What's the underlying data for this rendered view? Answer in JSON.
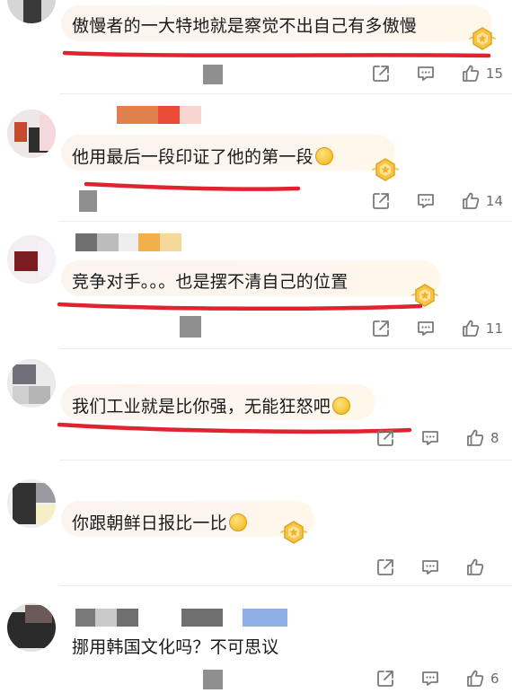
{
  "comments": [
    {
      "text": "傲慢者的一大特地就是察觉不出自己有多傲慢",
      "emoji": "",
      "likes": "15"
    },
    {
      "text": "他用最后一段印证了他的第一段",
      "emoji": "thinking-emoji",
      "likes": "14"
    },
    {
      "text": "竞争对手。。。也是摆不清自己的位置",
      "emoji": "",
      "likes": "11"
    },
    {
      "text": "我们工业就是比你强，无能狂怒吧",
      "emoji": "sweat-smile-emoji",
      "likes": "8"
    },
    {
      "text": "你跟朝鲜日报比一比",
      "emoji": "doge-emoji",
      "likes": ""
    },
    {
      "text": "挪用韩国文化吗？不可思议",
      "emoji": "",
      "likes": "6"
    }
  ],
  "icons": {
    "share": "share-icon",
    "comment": "comment-icon",
    "like": "thumbs-up-icon",
    "badge": "medal-badge-icon"
  },
  "colors": {
    "underline": "#e0232e",
    "icon": "#7a7a7a",
    "censor": "#8f8f8f"
  }
}
